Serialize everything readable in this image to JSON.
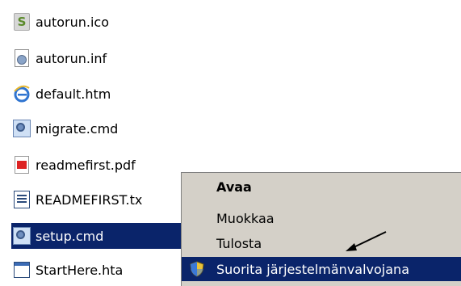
{
  "files": [
    {
      "name": "autorun.ico",
      "icon": "ico-file-icon"
    },
    {
      "name": "autorun.inf",
      "icon": "settings-file-icon"
    },
    {
      "name": "default.htm",
      "icon": "internet-explorer-icon"
    },
    {
      "name": "migrate.cmd",
      "icon": "cmd-script-icon"
    },
    {
      "name": "readmefirst.pdf",
      "icon": "pdf-icon"
    },
    {
      "name": "READMEFIRST.tx",
      "icon": "text-file-icon"
    },
    {
      "name": "setup.cmd",
      "icon": "cmd-script-icon",
      "selected": true
    },
    {
      "name": "StartHere.hta",
      "icon": "hta-window-icon"
    }
  ],
  "context_menu": {
    "items": [
      {
        "label": "Avaa",
        "bold": true
      },
      {
        "label": "Muokkaa"
      },
      {
        "label": "Tulosta"
      },
      {
        "label": "Suorita järjestelmänvalvojana",
        "icon": "uac-shield-icon",
        "highlighted": true
      }
    ]
  },
  "colors": {
    "selection": "#0a246a",
    "menu_background": "#d4d0c8",
    "selected_text": "#ffffff"
  }
}
